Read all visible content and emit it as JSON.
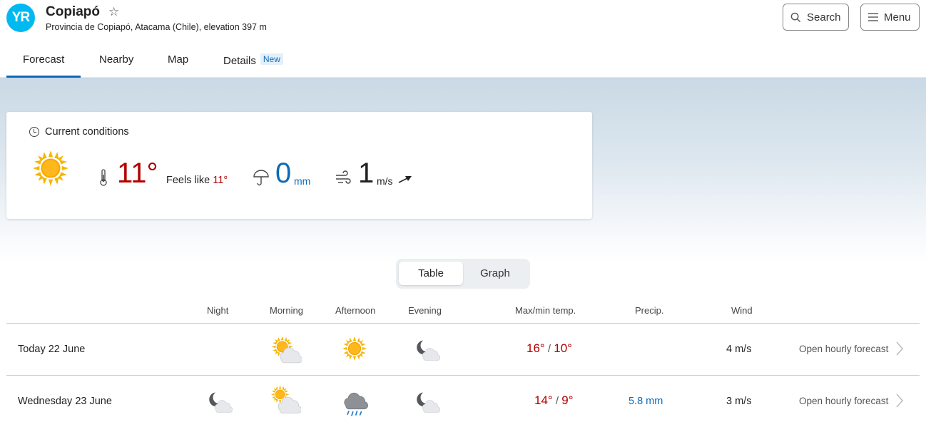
{
  "header": {
    "logo_text": "YR",
    "location": "Copiapó",
    "subtitle": "Provincia de Copiapó, Atacama (Chile), elevation 397 m",
    "search_label": "Search",
    "menu_label": "Menu"
  },
  "tabs": [
    {
      "label": "Forecast",
      "active": true
    },
    {
      "label": "Nearby"
    },
    {
      "label": "Map"
    },
    {
      "label": "Details",
      "badge": "New"
    }
  ],
  "current": {
    "title": "Current conditions",
    "icon": "clear-sun-icon",
    "temperature": "11°",
    "feels_like_label": "Feels like",
    "feels_like_value": "11°",
    "precipitation": "0",
    "precip_unit": "mm",
    "wind": "1",
    "wind_unit": "m/s"
  },
  "view_toggle": {
    "table_label": "Table",
    "graph_label": "Graph",
    "selected": "Table"
  },
  "columns": {
    "night": "Night",
    "morning": "Morning",
    "afternoon": "Afternoon",
    "evening": "Evening",
    "temp": "Max/min temp.",
    "precip": "Precip.",
    "wind": "Wind"
  },
  "days": [
    {
      "name": "Today 22 June",
      "icons": {
        "night": "",
        "morning": "partly-cloudy-sun-icon",
        "afternoon": "clear-sun-icon",
        "evening": "partly-cloudy-moon-icon"
      },
      "max": "16°",
      "min": "10°",
      "precip": "",
      "wind": "4 m/s",
      "link": "Open hourly forecast"
    },
    {
      "name": "Wednesday 23 June",
      "icons": {
        "night": "partly-cloudy-moon-icon",
        "morning": "partly-cloudy-sun-icon",
        "afternoon": "rain-cloud-icon",
        "evening": "partly-cloudy-moon-icon"
      },
      "max": "14°",
      "min": "9°",
      "precip": "5.8 mm",
      "wind": "3 m/s",
      "link": "Open hourly forecast"
    }
  ],
  "colors": {
    "brand": "#00b9f1",
    "warm_temp": "#b30000",
    "precip": "#0b6ab8",
    "accent": "#0b6ab8"
  }
}
